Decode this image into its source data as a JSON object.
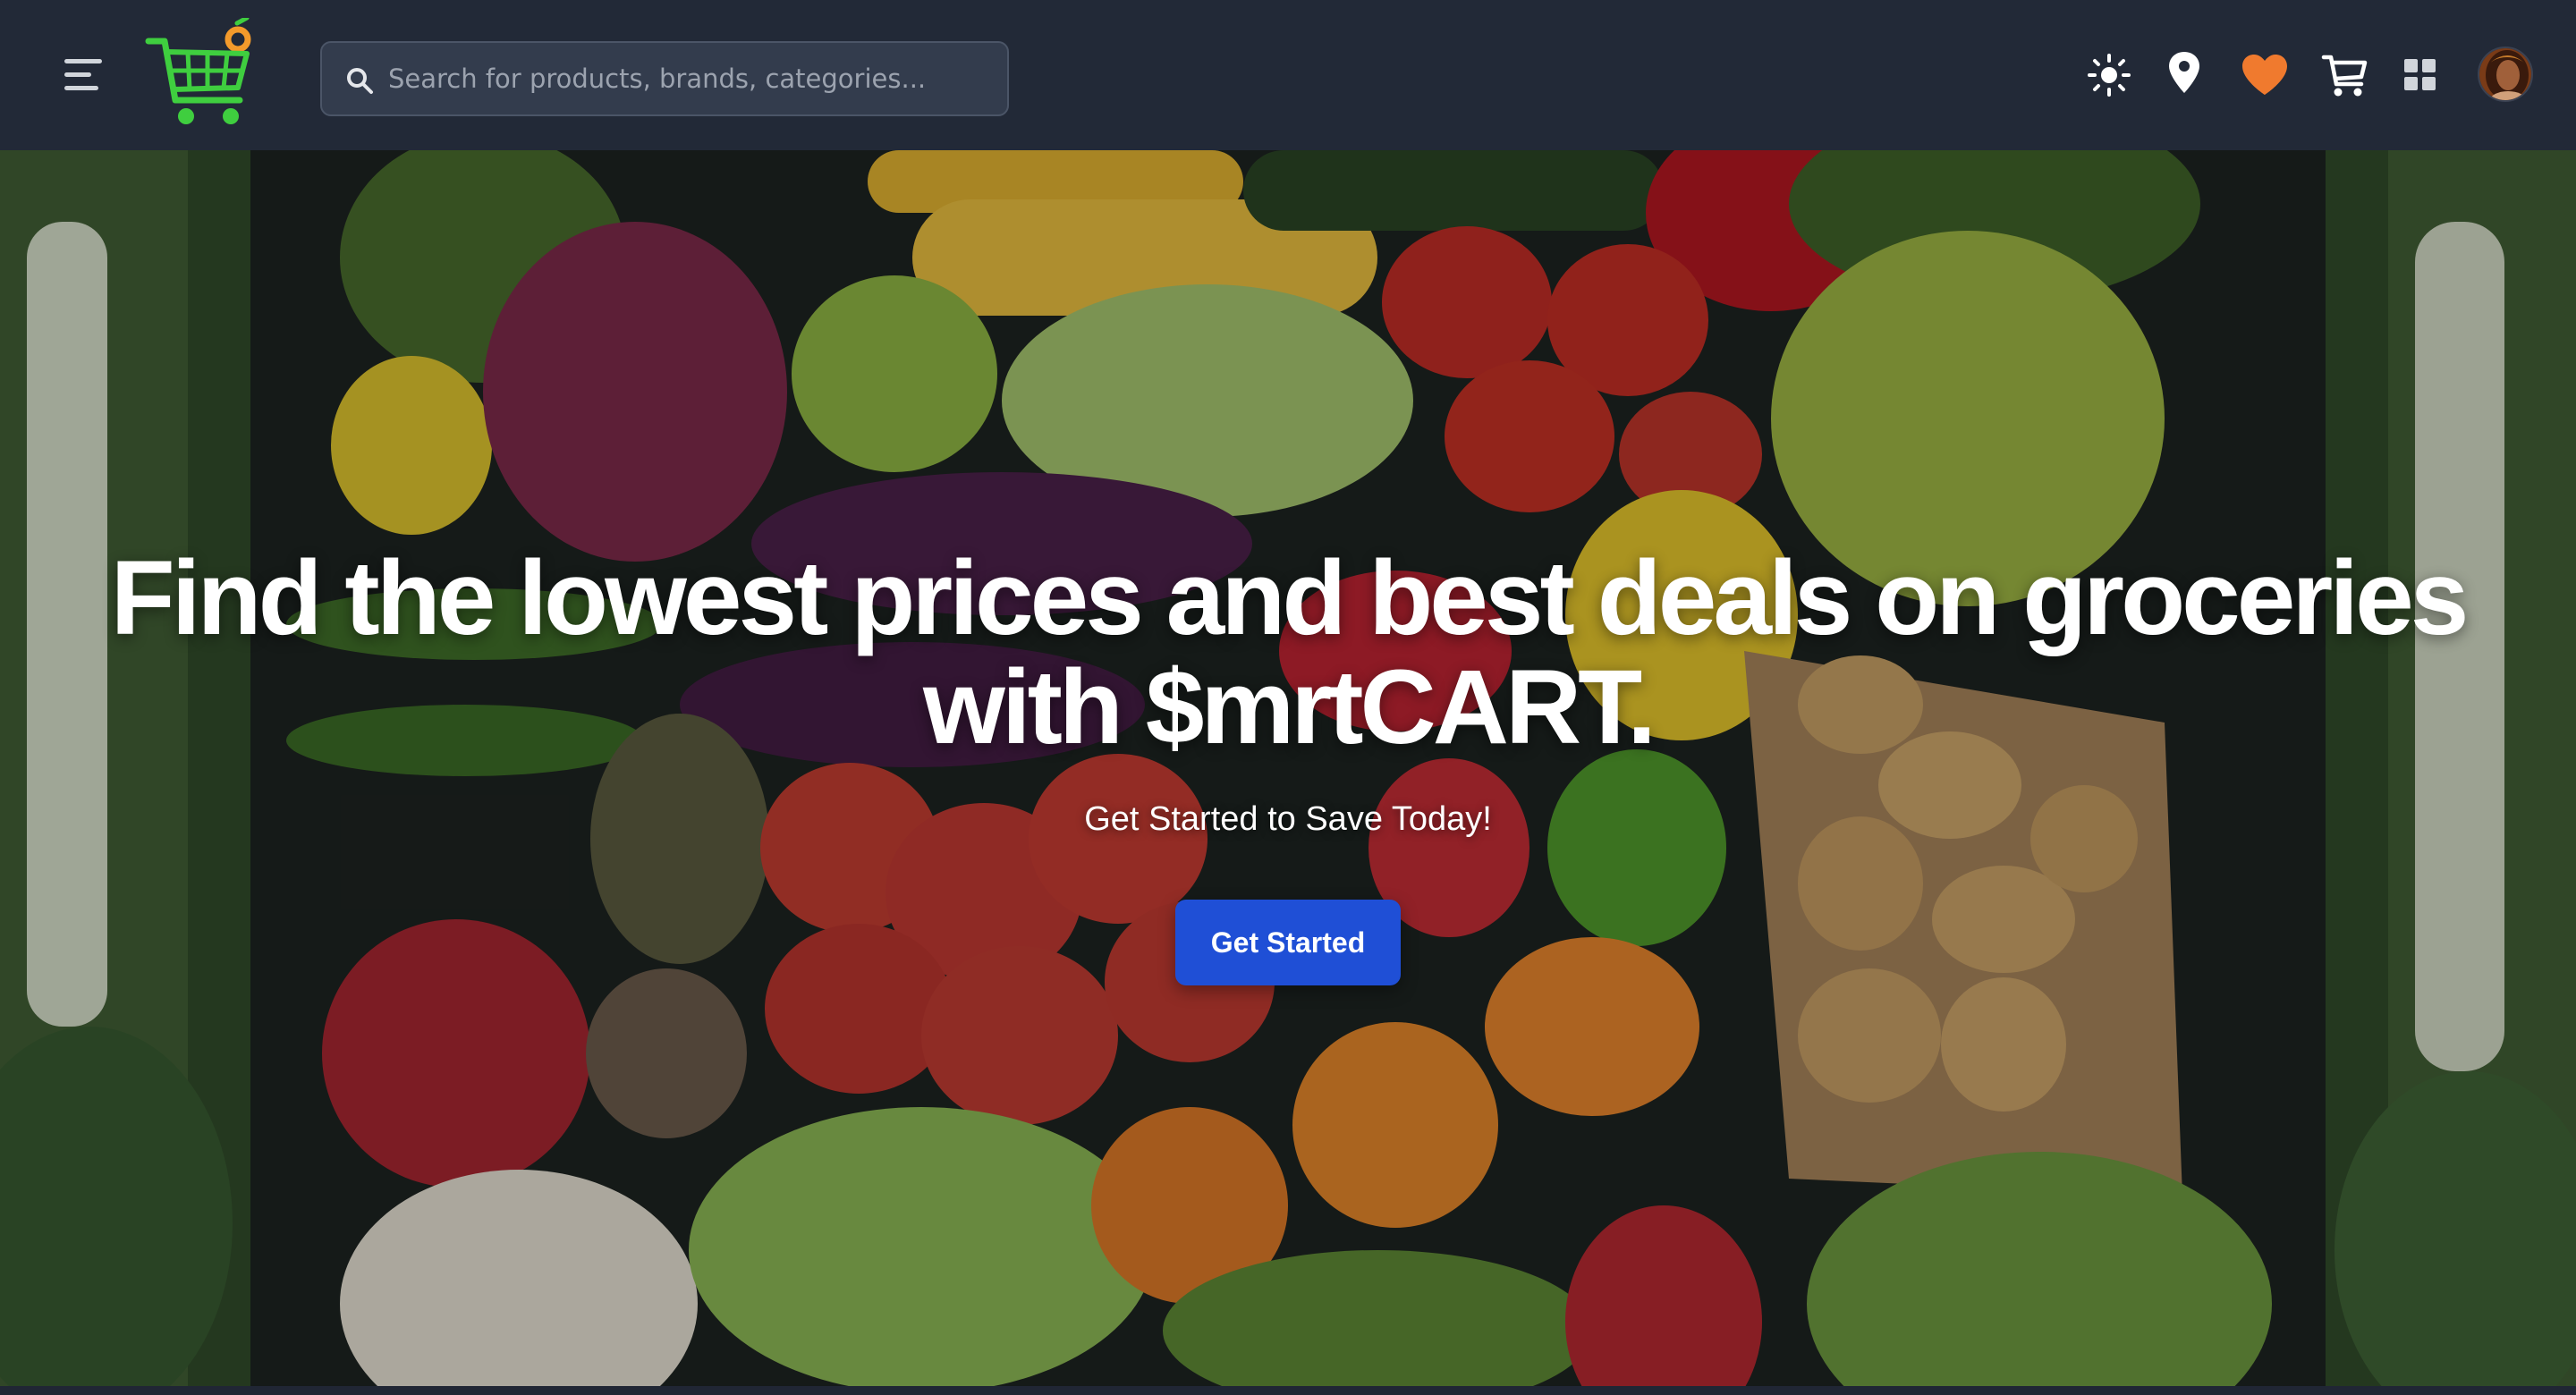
{
  "navbar": {
    "menu_icon": "hamburger-menu-icon",
    "logo_icon": "shopping-cart-logo",
    "search": {
      "placeholder": "Search for products, brands, categories...",
      "value": "",
      "icon": "search-icon"
    },
    "icons": [
      {
        "name": "theme-toggle",
        "icon": "sun-icon"
      },
      {
        "name": "location",
        "icon": "map-pin-icon"
      },
      {
        "name": "favorites",
        "icon": "heart-icon",
        "color": "#f07a2e"
      },
      {
        "name": "cart",
        "icon": "cart-icon"
      },
      {
        "name": "apps",
        "icon": "grid-icon"
      }
    ],
    "avatar": "user-avatar"
  },
  "hero": {
    "title_line1": "Find the lowest prices and best deals on groceries",
    "title_line2": "with $mrtCART.",
    "subtitle": "Get Started to Save Today!",
    "cta_label": "Get Started",
    "background": "fresh-vegetables-photo"
  },
  "colors": {
    "navbar_bg": "#222937",
    "search_bg": "#333c4d",
    "cta_bg": "#1f4fd6",
    "logo_green": "#3fce3f",
    "logo_orange": "#f39a2b",
    "heart_orange": "#f07a2e"
  }
}
